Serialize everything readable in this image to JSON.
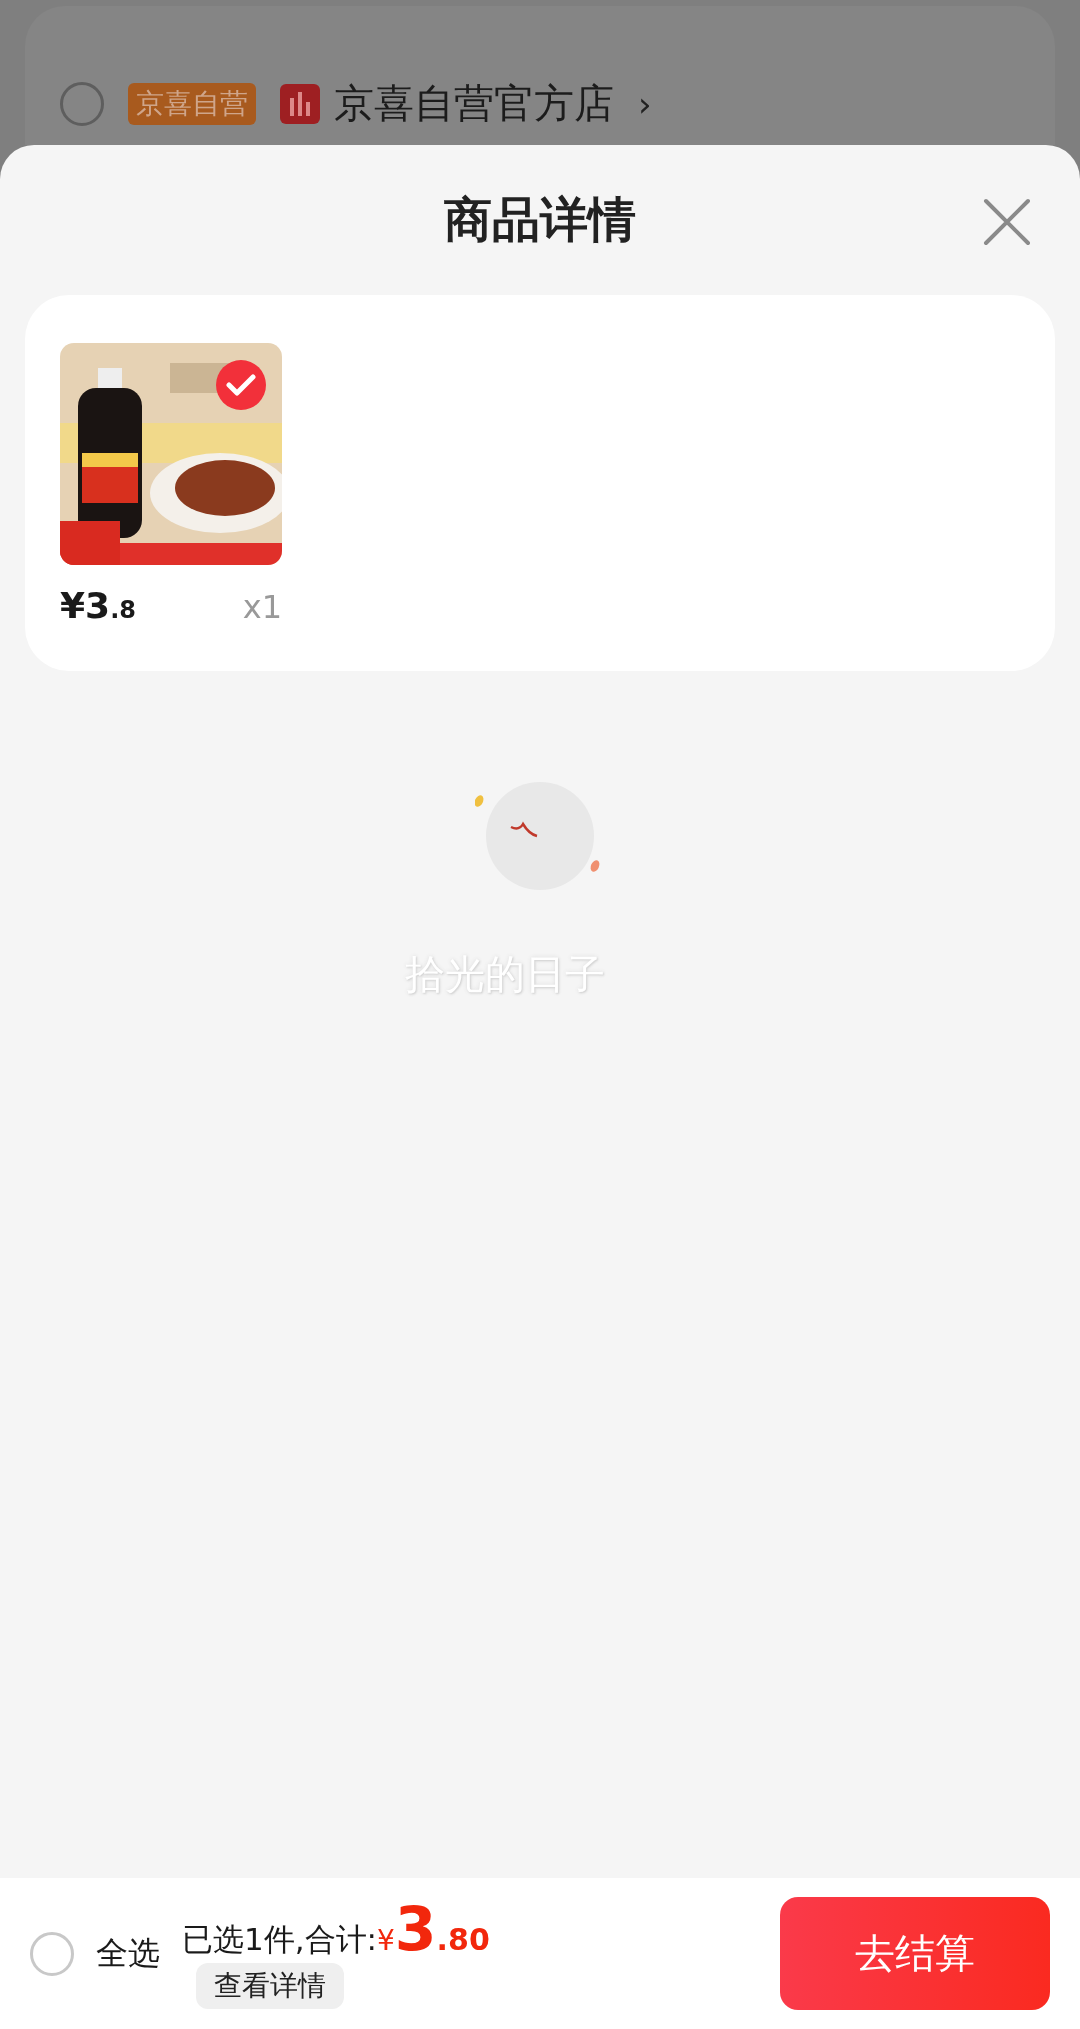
{
  "background_store": {
    "checked": false,
    "badge": "京喜自营",
    "name": "京喜自营官方店",
    "chevron": "›"
  },
  "sheet": {
    "title": "商品详情",
    "items": [
      {
        "kind": "picture",
        "selected": true,
        "price_symbol": "¥",
        "price_integer": "3",
        "price_decimal": ".8",
        "quantity": "x1"
      }
    ]
  },
  "loading": {
    "text": "拾光的日子"
  },
  "footer": {
    "select_all": {
      "label": "全选",
      "checked": false
    },
    "summary": "已选1件,合计:",
    "total": {
      "symbol": "¥",
      "integer": "3",
      "decimal": ".80"
    },
    "details_button": "查看详情",
    "checkout_button": "去结算"
  }
}
